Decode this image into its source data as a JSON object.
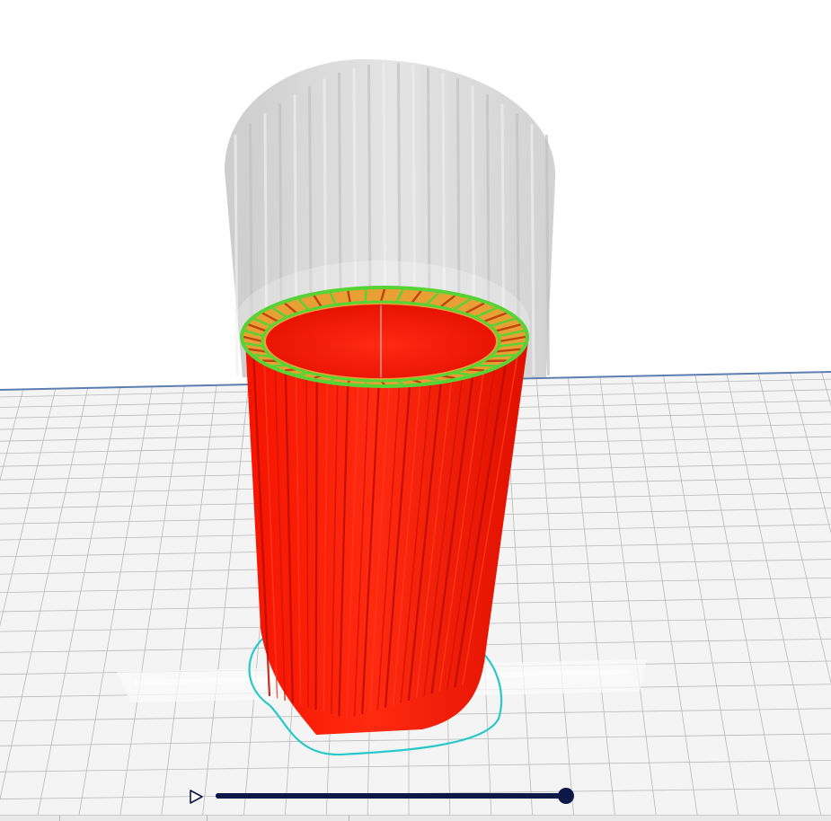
{
  "app": {
    "view": "layer-preview",
    "colors": {
      "background": "#ffffff",
      "build_plate": "#f4f4f4",
      "grid_line": "#b9b9b9",
      "plate_edge": "#5d7fb0",
      "outer_wall": "#ff1a00",
      "inner_wall": "#e81400",
      "infill_green": "#58d335",
      "infill_orange": "#e8a034",
      "ghost_model": "#d4d4d4",
      "skirt": "#29c9c9",
      "slider": "#0d1848"
    }
  },
  "simulation": {
    "play_icon": "play-icon",
    "layer_progress": 1.0
  }
}
